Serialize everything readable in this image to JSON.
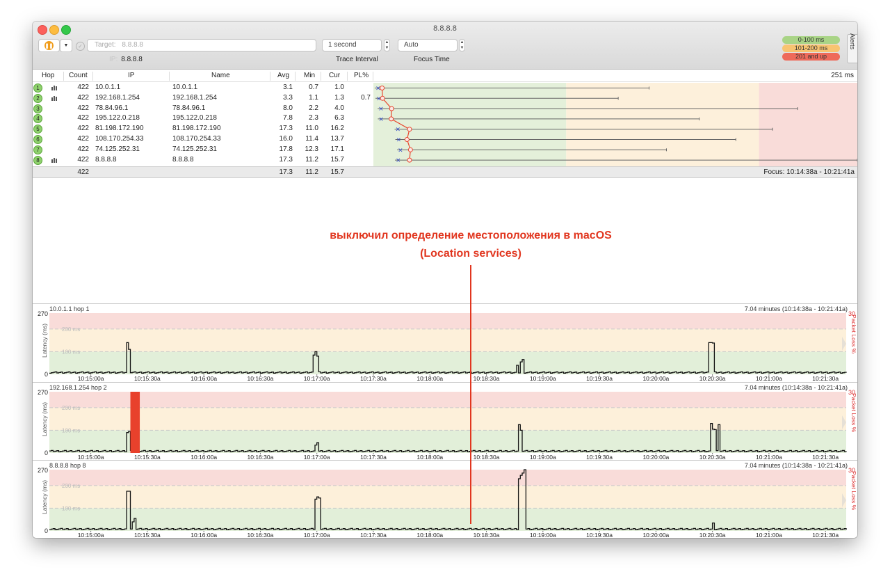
{
  "window": {
    "title": "8.8.8.8",
    "target_placeholder": "Target:",
    "target_value": "8.8.8.8",
    "ip_label": "IP:",
    "ip_value": "8.8.8.8",
    "trace_interval_value": "1 second",
    "trace_interval_label": "Trace Interval",
    "focus_time_value": "Auto",
    "focus_time_label": "Focus Time",
    "alerts_label": "Alerts",
    "legend": [
      {
        "label": "0-100 ms",
        "color": "#a9d486"
      },
      {
        "label": "101-200 ms",
        "color": "#f8c471"
      },
      {
        "label": "201 and up",
        "color": "#ee6a5a"
      }
    ]
  },
  "table": {
    "headers": {
      "hop": "Hop",
      "count": "Count",
      "ip": "IP",
      "name": "Name",
      "avg": "Avg",
      "min": "Min",
      "cur": "Cur",
      "pl": "PL%"
    },
    "scale_max_label": "251 ms",
    "rows": [
      {
        "hop": "1",
        "count": "422",
        "ip": "10.0.1.1",
        "name": "10.0.1.1",
        "avg": "3.1",
        "min": "0.7",
        "cur": "1.0",
        "pl": "",
        "graph": true,
        "avg_ms": 3.1,
        "min_ms": 0.7,
        "max_ms": 143
      },
      {
        "hop": "2",
        "count": "422",
        "ip": "192.168.1.254",
        "name": "192.168.1.254",
        "avg": "3.3",
        "min": "1.1",
        "cur": "1.3",
        "pl": "0.7",
        "graph": true,
        "avg_ms": 3.3,
        "min_ms": 1.1,
        "max_ms": 127
      },
      {
        "hop": "3",
        "count": "422",
        "ip": "78.84.96.1",
        "name": "78.84.96.1",
        "avg": "8.0",
        "min": "2.2",
        "cur": "4.0",
        "pl": "",
        "graph": false,
        "avg_ms": 8.0,
        "min_ms": 2.2,
        "max_ms": 220
      },
      {
        "hop": "4",
        "count": "422",
        "ip": "195.122.0.218",
        "name": "195.122.0.218",
        "avg": "7.8",
        "min": "2.3",
        "cur": "6.3",
        "pl": "",
        "graph": false,
        "avg_ms": 7.8,
        "min_ms": 2.3,
        "max_ms": 169
      },
      {
        "hop": "5",
        "count": "422",
        "ip": "81.198.172.190",
        "name": "81.198.172.190",
        "avg": "17.3",
        "min": "11.0",
        "cur": "16.2",
        "pl": "",
        "graph": false,
        "avg_ms": 17.3,
        "min_ms": 11.0,
        "max_ms": 207
      },
      {
        "hop": "6",
        "count": "422",
        "ip": "108.170.254.33",
        "name": "108.170.254.33",
        "avg": "16.0",
        "min": "11.4",
        "cur": "13.7",
        "pl": "",
        "graph": false,
        "avg_ms": 16.0,
        "min_ms": 11.4,
        "max_ms": 188
      },
      {
        "hop": "7",
        "count": "422",
        "ip": "74.125.252.31",
        "name": "74.125.252.31",
        "avg": "17.8",
        "min": "12.3",
        "cur": "17.1",
        "pl": "",
        "graph": false,
        "avg_ms": 17.8,
        "min_ms": 12.3,
        "max_ms": 152
      },
      {
        "hop": "8",
        "count": "422",
        "ip": "8.8.8.8",
        "name": "8.8.8.8",
        "avg": "17.3",
        "min": "11.2",
        "cur": "15.7",
        "pl": "",
        "graph": true,
        "avg_ms": 17.3,
        "min_ms": 11.2,
        "max_ms": 251
      }
    ],
    "summary": {
      "count": "422",
      "avg": "17.3",
      "min": "11.2",
      "cur": "15.7",
      "focus": "Focus: 10:14:38a - 10:21:41a"
    }
  },
  "annotation": {
    "line1": "выключил определение местоположения в macOS",
    "line2": "(Location services)"
  },
  "graphs": [
    {
      "title": "10.0.1.1 hop 1",
      "range": "7.04 minutes (10:14:38a - 10:21:41a)"
    },
    {
      "title": "192.168.1.254 hop 2",
      "range": "7.04 minutes (10:14:38a - 10:21:41a)"
    },
    {
      "title": "8.8.8.8 hop 8",
      "range": "7.04 minutes (10:14:38a - 10:21:41a)"
    }
  ],
  "chart_data": {
    "type": "line",
    "ylabel": "Latency (ms)",
    "y2label": "Packet Loss %",
    "ylim": [
      0,
      270
    ],
    "y_ticks": [
      "0",
      "100 ms",
      "200 ms",
      "270"
    ],
    "y2_max": "30",
    "x_ticks": [
      "10:15:00a",
      "10:15:30a",
      "10:16:00a",
      "10:16:30a",
      "10:17:00a",
      "10:17:30a",
      "10:18:00a",
      "10:18:30a",
      "10:19:00a",
      "10:19:30a",
      "10:20:00a",
      "10:20:30a",
      "10:21:00a",
      "10:21:30a"
    ],
    "x_range_seconds": [
      0,
      423
    ],
    "zones": [
      {
        "from": 0,
        "to": 100,
        "color": "#e2efd9"
      },
      {
        "from": 100,
        "to": 200,
        "color": "#fdf0da"
      },
      {
        "from": 200,
        "to": 270,
        "color": "#f9dcd9"
      }
    ],
    "series": [
      {
        "spikes": [
          [
            41,
            140
          ],
          [
            42,
            110
          ],
          [
            140,
            85
          ],
          [
            141,
            100
          ],
          [
            142,
            80
          ],
          [
            248,
            40
          ],
          [
            250,
            55
          ],
          [
            251,
            65
          ],
          [
            350,
            140
          ],
          [
            351,
            140
          ],
          [
            352,
            138
          ]
        ],
        "loss": []
      },
      {
        "spikes": [
          [
            41,
            90
          ],
          [
            42,
            95
          ],
          [
            141,
            35
          ],
          [
            142,
            45
          ],
          [
            249,
            125
          ],
          [
            250,
            100
          ],
          [
            351,
            130
          ],
          [
            352,
            105
          ],
          [
            353,
            103
          ],
          [
            355,
            125
          ]
        ],
        "loss": [
          [
            43,
            48
          ]
        ]
      },
      {
        "spikes": [
          [
            41,
            175
          ],
          [
            42,
            175
          ],
          [
            44,
            40
          ],
          [
            45,
            55
          ],
          [
            141,
            140
          ],
          [
            142,
            150
          ],
          [
            143,
            145
          ],
          [
            249,
            230
          ],
          [
            250,
            245
          ],
          [
            251,
            255
          ],
          [
            252,
            270
          ],
          [
            352,
            35
          ]
        ],
        "loss": []
      }
    ]
  }
}
